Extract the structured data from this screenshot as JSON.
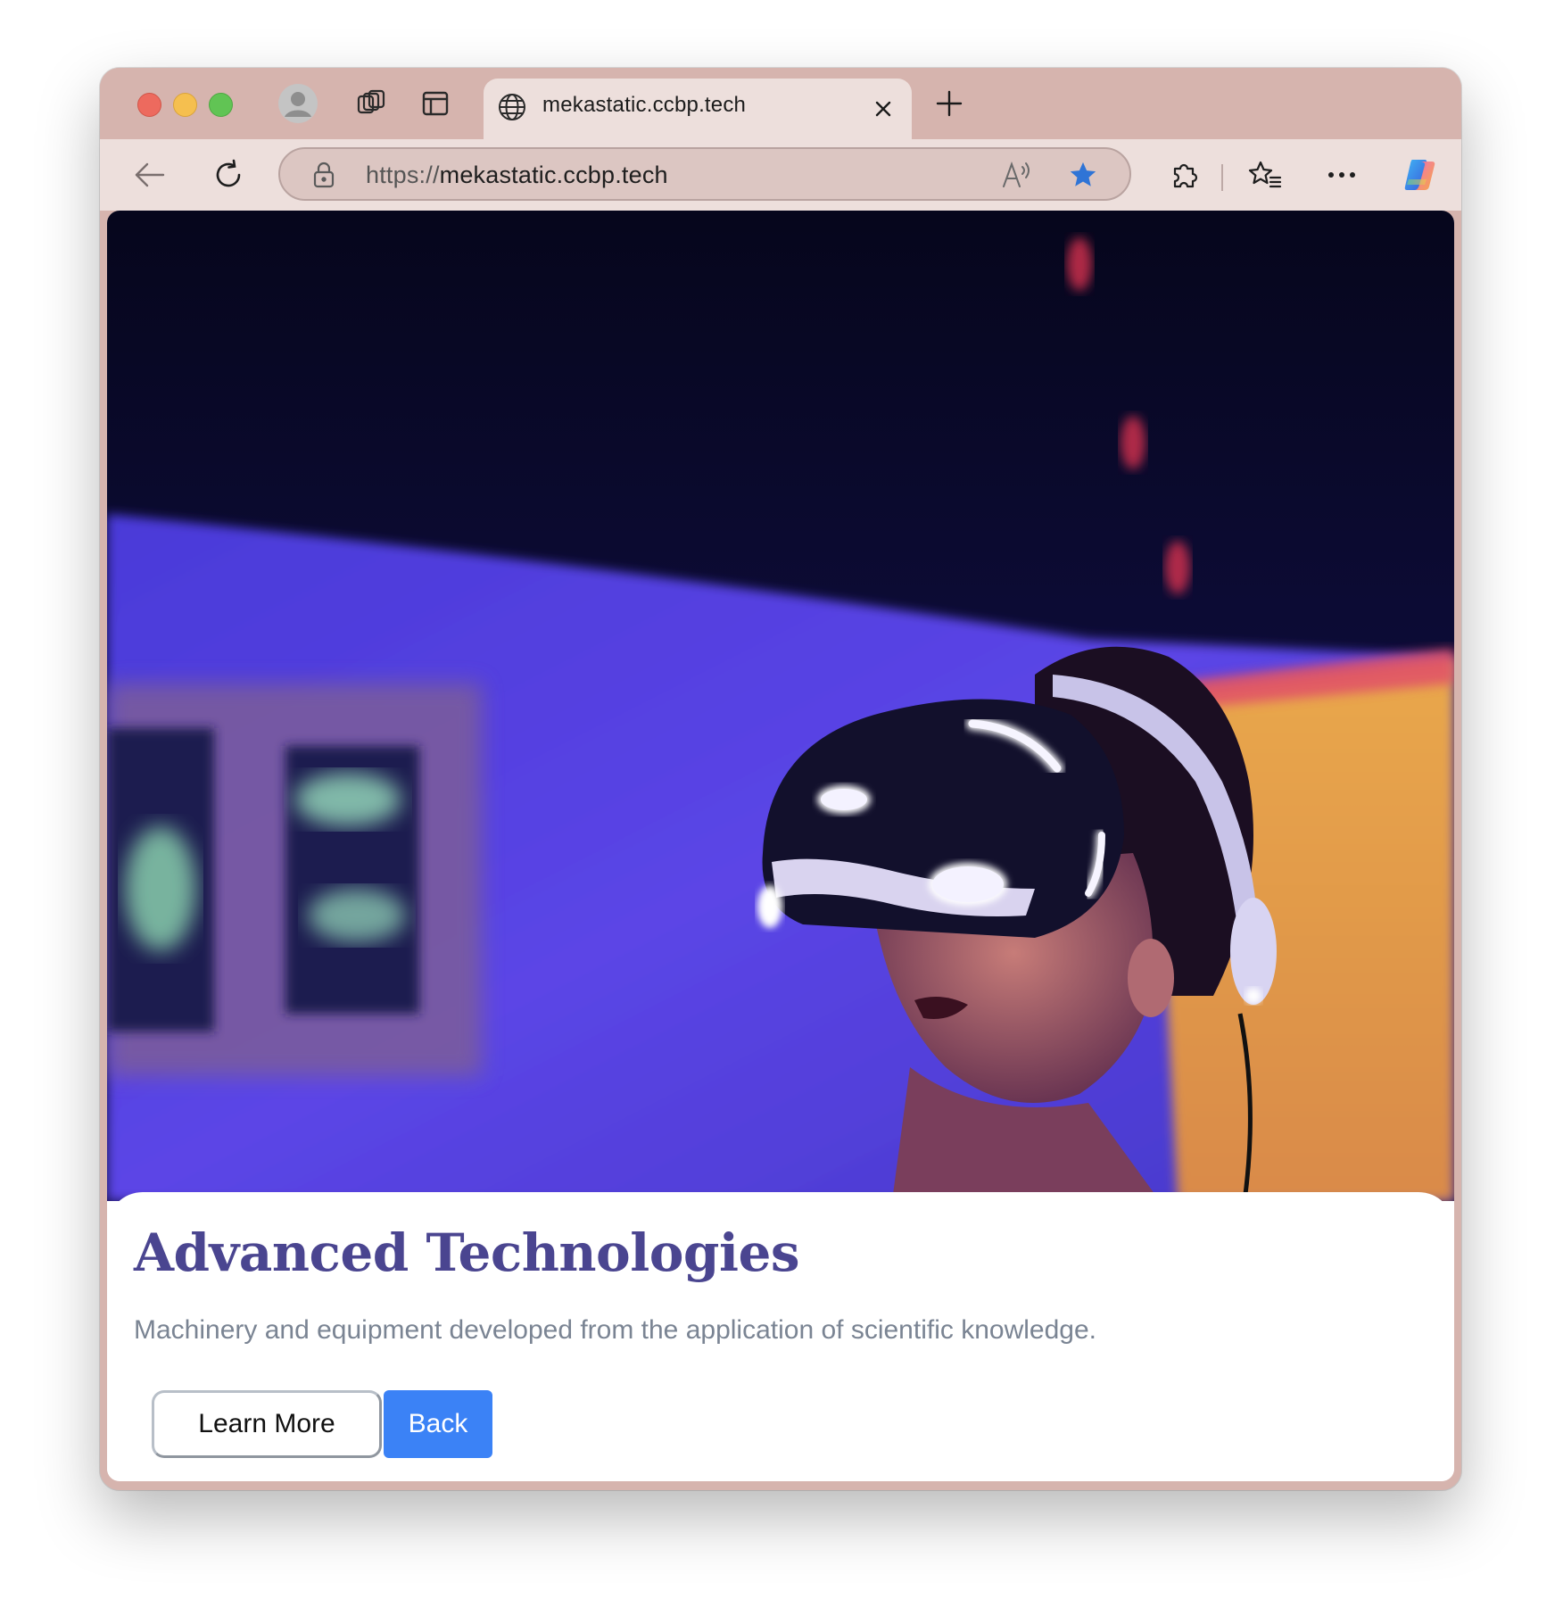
{
  "browser": {
    "tab": {
      "title": "mekastatic.ccbp.tech",
      "icon": "globe-icon"
    },
    "address_bar": {
      "scheme": "https://",
      "host": "mekastatic.ccbp.tech"
    },
    "icons": {
      "profile": "profile-icon",
      "workspaces": "workspaces-icon",
      "tab_actions": "vertical-tabs-icon",
      "close_tab": "close-icon",
      "new_tab": "plus-icon",
      "back": "back-arrow-icon",
      "reload": "reload-icon",
      "lock": "lock-icon",
      "read_aloud": "read-aloud-icon",
      "favorite": "star-icon",
      "extensions": "puzzle-icon",
      "favorites": "favorites-icon",
      "more": "more-icon",
      "copilot": "copilot-icon"
    },
    "colors": {
      "frame": "#d6b4ae",
      "toolbar": "#eddfdc",
      "star": "#2f74d6"
    }
  },
  "page": {
    "hero_image": "VR headset user photo",
    "title": "Advanced Technologies",
    "description": "Machinery and equipment developed from the application of scientific knowledge.",
    "buttons": {
      "learn_more": "Learn More",
      "back": "Back"
    },
    "colors": {
      "title": "#4a4590",
      "description": "#7a8493",
      "back_button": "#3b82f6"
    }
  }
}
